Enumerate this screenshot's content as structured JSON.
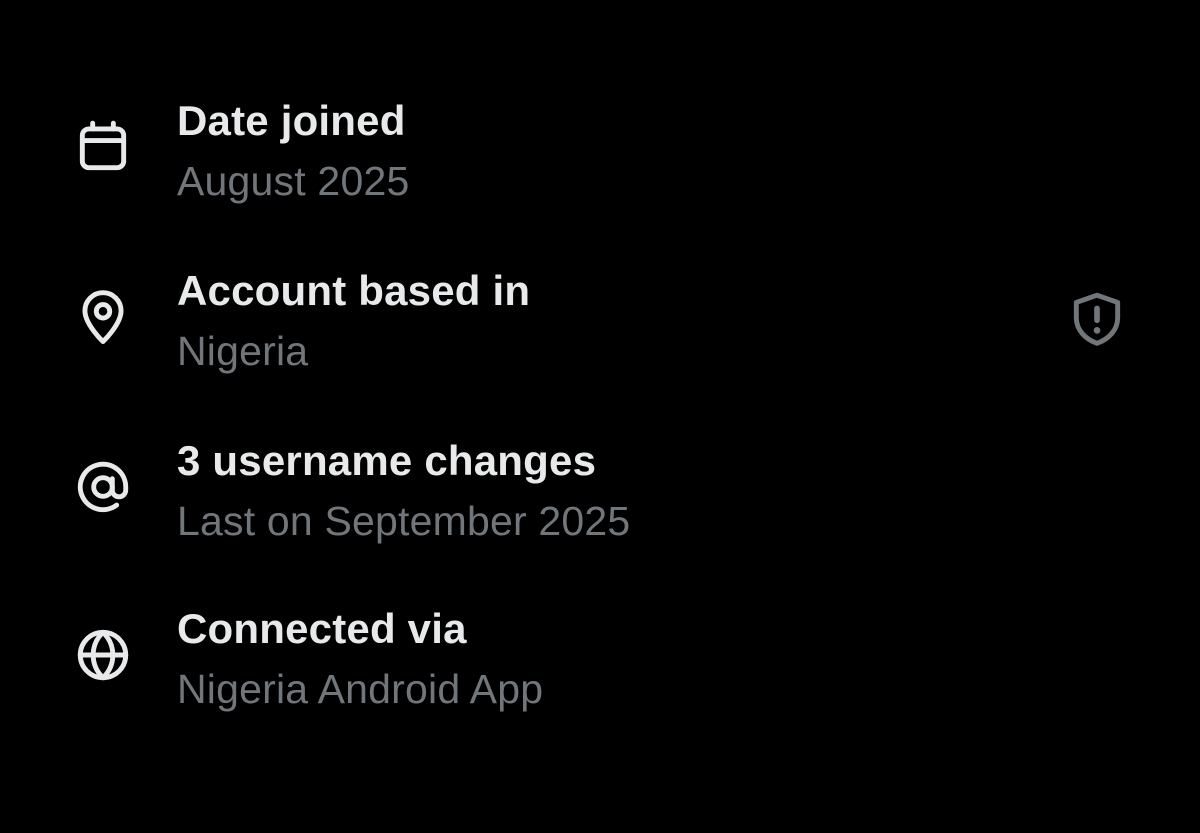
{
  "colors": {
    "background": "#000000",
    "primary_text": "#e7e9ea",
    "secondary_text": "#71767b"
  },
  "rows": [
    {
      "icon": "calendar-icon",
      "title": "Date joined",
      "subtitle": "August 2025"
    },
    {
      "icon": "location-pin-icon",
      "title": "Account based in",
      "subtitle": "Nigeria",
      "trailing_icon": "shield-alert-icon"
    },
    {
      "icon": "at-sign-icon",
      "title": "3 username changes",
      "subtitle": "Last on September 2025"
    },
    {
      "icon": "globe-icon",
      "title": "Connected via",
      "subtitle": "Nigeria Android App"
    }
  ]
}
